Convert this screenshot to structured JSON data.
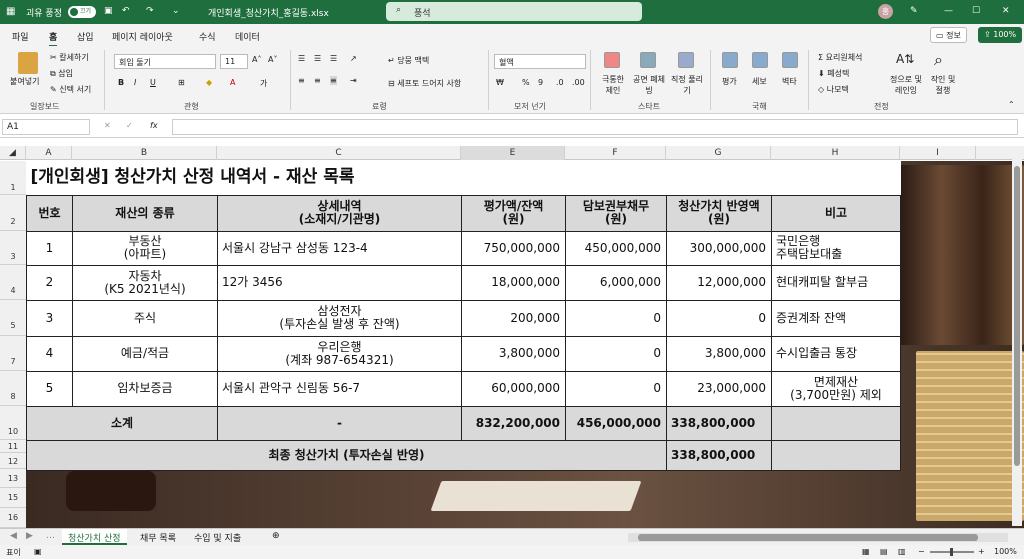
{
  "titlebar": {
    "autosave": "괴유 풍정",
    "toggle": "끄기",
    "filename": "개인회생_청산가치_홍길동.xlsx",
    "search": "풍석",
    "avatar": "홍"
  },
  "menu": {
    "items": [
      "파일",
      "홈",
      "삽입",
      "페이지 레이아웃",
      "수식",
      "데이터"
    ],
    "memo": "정보",
    "zoom_btn": "100%"
  },
  "ribbon": {
    "clipboard": {
      "paste": "붙여넣기",
      "cut": "칼세하기",
      "copy": "삽입",
      "format": "신텍 서기",
      "group": "일장보드"
    },
    "font": {
      "name": "회입 둘기",
      "size": "11",
      "group": "관형"
    },
    "align": {
      "wrap": "당뭉 맥텍",
      "merge": "세프토 드어지 사항",
      "group": "료령"
    },
    "number": {
      "format": "혈액",
      "group": "모저 넌기"
    },
    "styles": {
      "cond": "극통한 제인",
      "table": "공면 폐체 빙",
      "cell": "직정 풀리기",
      "group": "스타트"
    },
    "cells": {
      "insert": "평가",
      "delete": "세보",
      "format": "벽타",
      "group": "국해"
    },
    "editing": {
      "sum": "요리원체석",
      "fill": "폐성텍",
      "clear": "나모텍",
      "sort": "정으로 및 레인잉",
      "find": "작인 및 절챙",
      "group": "전정"
    }
  },
  "formula_bar": {
    "namebox": "A1",
    "fx": "fx"
  },
  "columns": [
    "A",
    "B",
    "C",
    "E",
    "F",
    "G",
    "H",
    "I"
  ],
  "rows": [
    "1",
    "2",
    "3",
    "4",
    "5",
    "7",
    "8",
    "10",
    "11",
    "12",
    "13",
    "15",
    "16"
  ],
  "sheet": {
    "title": "[개인회생] 청산가치 산정 내역서 - 재산 목록",
    "headers": {
      "no": "번호",
      "type": "재산의 종류",
      "detail1": "상세내역",
      "detail2": "(소재지/기관명)",
      "value1": "평가액/잔액",
      "value2": "(원)",
      "debt1": "담보권부채무",
      "debt2": "(원)",
      "liq1": "청산가치 반영액",
      "liq2": "(원)",
      "note": "비고"
    },
    "rows": [
      {
        "no": "1",
        "type1": "부동산",
        "type2": "(아파트)",
        "detail1": "서울시 강남구 삼성동 123-4",
        "detail2": "",
        "value": "750,000,000",
        "debt": "450,000,000",
        "liq": "300,000,000",
        "note1": "국민은행",
        "note2": "주택담보대출"
      },
      {
        "no": "2",
        "type1": "자동차",
        "type2": "(K5 2021년식)",
        "detail1": "12가 3456",
        "detail2": "",
        "value": "18,000,000",
        "debt": "6,000,000",
        "liq": "12,000,000",
        "note1": "현대캐피탈 할부금",
        "note2": ""
      },
      {
        "no": "3",
        "type1": "주식",
        "type2": "",
        "detail1": "삼성전자",
        "detail2": "(투자손실 발생 후 잔액)",
        "value": "200,000",
        "debt": "0",
        "liq": "0",
        "note1": "증권계좌 잔액",
        "note2": ""
      },
      {
        "no": "4",
        "type1": "예금/적금",
        "type2": "",
        "detail1": "우리은행",
        "detail2": "(계좌 987-654321)",
        "value": "3,800,000",
        "debt": "0",
        "liq": "3,800,000",
        "note1": "수시입출금 통장",
        "note2": ""
      },
      {
        "no": "5",
        "type1": "임차보증금",
        "type2": "",
        "detail1": "서울시 관악구 신림동 56-7",
        "detail2": "",
        "value": "60,000,000",
        "debt": "0",
        "liq": "23,000,000",
        "note1": "면제재산",
        "note2": "(3,700만원) 제외"
      }
    ],
    "subtotal": {
      "label": "소계",
      "detail": "-",
      "value": "832,200,000",
      "debt": "456,000,000",
      "liq": "338,800,000"
    },
    "final": {
      "label": "최종 청산가치 (투자손실 반영)",
      "liq": "338,800,000"
    }
  },
  "tabs": [
    "청산가치 산정",
    "채무 목록",
    "수입 및 지출"
  ],
  "status": {
    "ready": "표이",
    "zoom": "100%"
  }
}
